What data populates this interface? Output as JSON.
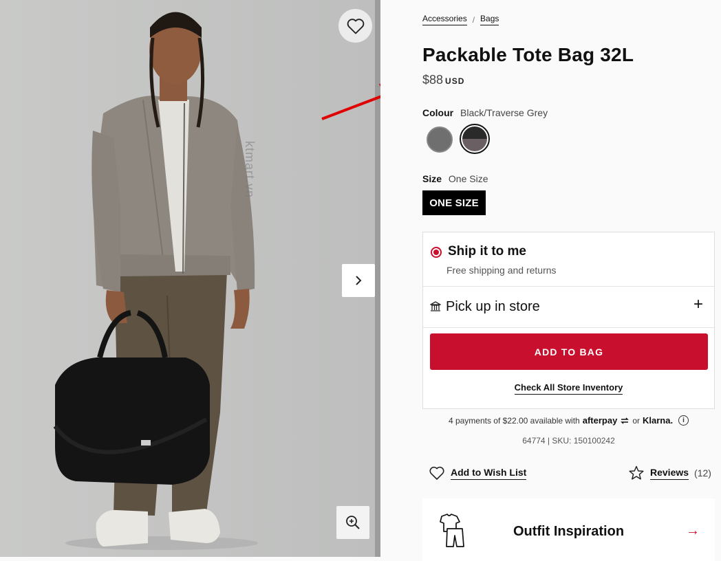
{
  "gallery": {
    "watermark": "ktmart.vn",
    "wishlist_icon": "heart-outline-icon",
    "next_icon": "chevron-right-icon",
    "zoom_icon": "zoom-in-icon"
  },
  "breadcrumb": [
    "Accessories",
    "Bags"
  ],
  "breadcrumb_separator": "/",
  "product": {
    "title": "Packable Tote Bag 32L",
    "price": "$88",
    "currency": "USD"
  },
  "colour": {
    "label": "Colour",
    "value": "Black/Traverse Grey",
    "swatches": [
      {
        "name": "grey",
        "color": "#6f6f6f",
        "selected": false
      },
      {
        "name": "black-traverse-grey",
        "color": "#2a2a2a",
        "selected": true
      }
    ]
  },
  "size": {
    "label": "Size",
    "value": "One Size",
    "button": "ONE SIZE"
  },
  "fulfilment": {
    "ship_title": "Ship it to me",
    "ship_subtitle": "Free shipping and returns",
    "pickup_label": "Pick up in store",
    "plus": "+",
    "add_to_bag": "ADD TO BAG",
    "check_inventory": "Check All Store Inventory"
  },
  "payments": {
    "text": "4 payments of $22.00 available with",
    "afterpay": "afterpay",
    "or": "or",
    "klarna": "Klarna.",
    "info": "i"
  },
  "sku": "64774 | SKU: 150100242",
  "actions": {
    "wishlist": "Add to Wish List",
    "reviews": "Reviews",
    "reviews_count": "(12)"
  },
  "outfit": {
    "title": "Outfit Inspiration",
    "arrow": "→"
  },
  "colors": {
    "accent_red": "#c8102e",
    "annotation_red": "#d0021b",
    "background": "#fafafa"
  }
}
